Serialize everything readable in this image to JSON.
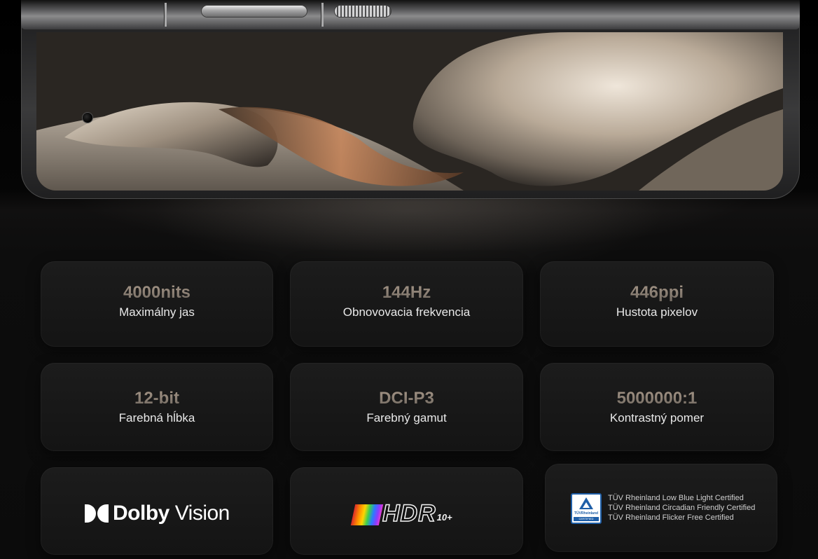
{
  "specs": [
    {
      "value": "4000nits",
      "label": "Maximálny jas"
    },
    {
      "value": "144Hz",
      "label": "Obnovovacia frekvencia"
    },
    {
      "value": "446ppi",
      "label": "Hustota pixelov"
    },
    {
      "value": "12-bit",
      "label": "Farebná hĺbka"
    },
    {
      "value": "DCI-P3",
      "label": "Farebný gamut"
    },
    {
      "value": "5000000:1",
      "label": "Kontrastný pomer"
    }
  ],
  "logos": {
    "dolby": {
      "brand": "Dolby",
      "product": "Vision",
      "icon": "dolby-double-d-icon"
    },
    "hdr": {
      "main": "HDR",
      "sub": "10+",
      "icon": "hdr10-plus-logo"
    },
    "tuv": {
      "badge_brand": "TÜVRheinland",
      "badge_label": "CERTIFIED",
      "lines": [
        "TÜV Rheinland Low Blue Light Certified",
        "TÜV Rheinland Circadian Friendly Certified",
        "TÜV Rheinland Flicker Free Certified"
      ]
    }
  },
  "colors": {
    "background": "#0b0b0b",
    "card": "#181818",
    "value_gradient": [
      "#a8998a",
      "#6e665e"
    ],
    "label": "#e9e9e9",
    "tuv_blue": "#1f5fa8"
  }
}
